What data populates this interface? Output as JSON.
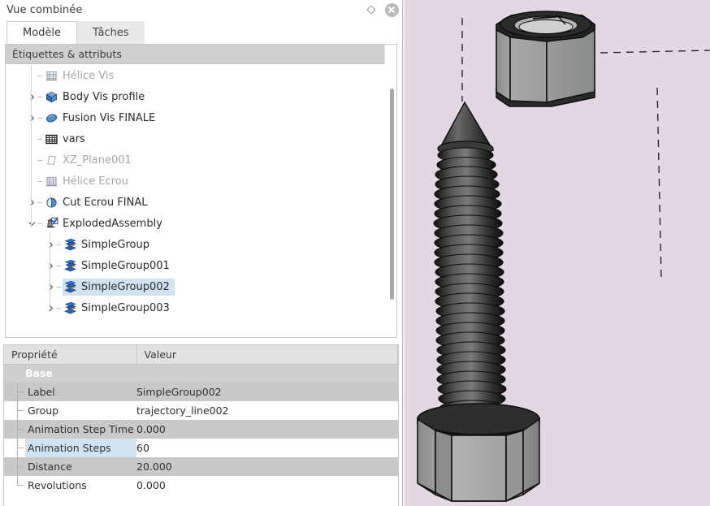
{
  "dock": {
    "title": "Vue combinée",
    "buttons": [
      {
        "name": "float-icon",
        "glyph": "diamond"
      },
      {
        "name": "close-icon",
        "glyph": "close"
      }
    ]
  },
  "tabs": [
    {
      "id": "modele",
      "label": "Modèle",
      "active": true
    },
    {
      "id": "taches",
      "label": "Tâches",
      "active": false
    }
  ],
  "tree": {
    "header": "Étiquettes & attributs",
    "items": [
      {
        "label": "Hélice Vis",
        "icon": "helix-icon",
        "depth": 1,
        "arrow": "none",
        "dim": true,
        "selected": false
      },
      {
        "label": "Body Vis profile",
        "icon": "solid-icon",
        "depth": 1,
        "arrow": "collapsed",
        "dim": false,
        "selected": false
      },
      {
        "label": "Fusion Vis FINALE",
        "icon": "fusion-icon",
        "depth": 1,
        "arrow": "collapsed",
        "dim": false,
        "selected": false
      },
      {
        "label": "vars",
        "icon": "spreadsheet-icon",
        "depth": 1,
        "arrow": "none",
        "dim": false,
        "selected": false
      },
      {
        "label": "XZ_Plane001",
        "icon": "plane-icon",
        "depth": 1,
        "arrow": "none",
        "dim": true,
        "selected": false
      },
      {
        "label": "Hélice Ecrou",
        "icon": "helix-icon",
        "depth": 1,
        "arrow": "none",
        "dim": true,
        "selected": false
      },
      {
        "label": "Cut Ecrou FINAL",
        "icon": "cut-icon",
        "depth": 1,
        "arrow": "collapsed",
        "dim": false,
        "selected": false
      },
      {
        "label": "ExplodedAssembly",
        "icon": "exploded-icon",
        "depth": 1,
        "arrow": "expanded",
        "dim": false,
        "selected": false
      },
      {
        "label": "SimpleGroup",
        "icon": "group-icon",
        "depth": 2,
        "arrow": "collapsed",
        "dim": false,
        "selected": false
      },
      {
        "label": "SimpleGroup001",
        "icon": "group-icon",
        "depth": 2,
        "arrow": "collapsed",
        "dim": false,
        "selected": false
      },
      {
        "label": "SimpleGroup002",
        "icon": "group-icon",
        "depth": 2,
        "arrow": "collapsed",
        "dim": false,
        "selected": true
      },
      {
        "label": "SimpleGroup003",
        "icon": "group-icon",
        "depth": 2,
        "arrow": "collapsed",
        "dim": false,
        "selected": false
      }
    ]
  },
  "properties": {
    "headers": {
      "name": "Propriété",
      "value": "Valeur"
    },
    "group_label": "Base",
    "rows": [
      {
        "name": "Label",
        "value": "SimpleGroup002",
        "shaded": true,
        "highlighted": false
      },
      {
        "name": "Group",
        "value": "trajectory_line002",
        "shaded": false,
        "highlighted": false
      },
      {
        "name": "Animation Step Time",
        "value": "0.000",
        "shaded": true,
        "highlighted": false
      },
      {
        "name": "Animation Steps",
        "value": "60",
        "shaded": false,
        "highlighted": true
      },
      {
        "name": "Distance",
        "value": "20.000",
        "shaded": true,
        "highlighted": false
      },
      {
        "name": "Revolutions",
        "value": "0.000",
        "shaded": false,
        "highlighted": false
      }
    ]
  },
  "view3d": {
    "name": "3d-viewport",
    "background_color": "#e3d7e3",
    "objects": [
      {
        "name": "hex-nut",
        "description": "exploded hex nut above the bolt"
      },
      {
        "name": "hex-bolt",
        "description": "threaded bolt with conical tip and hex head"
      },
      {
        "name": "trajectory-line-vertical-left",
        "style": "dashed"
      },
      {
        "name": "trajectory-line-horizontal-top",
        "style": "dashed"
      },
      {
        "name": "trajectory-line-vertical-right",
        "style": "dashed"
      }
    ],
    "colors": {
      "metal_light": "#a8a8a8",
      "metal_mid": "#8f8f8f",
      "metal_dark": "#3a3a3a",
      "thread_dark": "#2e2e2e",
      "outline": "#111111"
    }
  }
}
